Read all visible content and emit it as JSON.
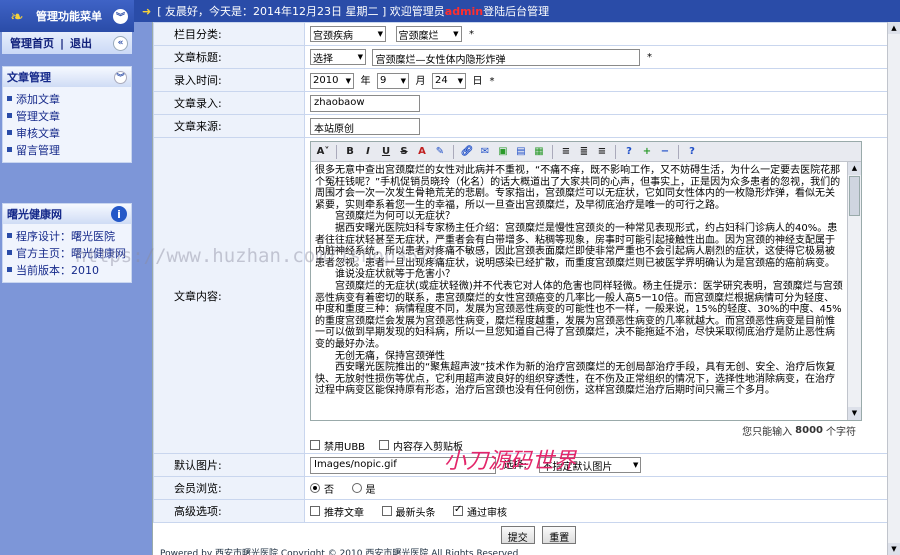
{
  "sidebar": {
    "header_title": "管理功能菜单",
    "nav_home": "管理首页",
    "nav_sep": "|",
    "nav_logout": "退出",
    "article_box": {
      "title": "文章管理",
      "items": [
        "添加文章",
        "管理文章",
        "审核文章",
        "留言管理"
      ]
    },
    "info_box": {
      "title": "曙光健康网",
      "items": [
        "程序设计：曙光医院",
        "官方主页：曙光健康网",
        "当前版本：2010"
      ]
    }
  },
  "topbar": {
    "text_before": "[ 友晨好，今天是：2014年12月23日 星期二 ] 欢迎管理员",
    "admin_name": "admin",
    "text_after": "登陆后台管理"
  },
  "form": {
    "category_label": "栏目分类:",
    "category_value": "宫颈疾病",
    "subcategory_value": "宫颈糜烂",
    "title_label": "文章标题:",
    "title_select": "选择",
    "title_value": "宫颈糜烂—女性体内隐形炸弹",
    "date_label": "录入时间:",
    "year_value": "2010",
    "year_unit": "年",
    "month_value": "9",
    "month_unit": "月",
    "day_value": "24",
    "day_unit": "日",
    "author_label": "文章录入:",
    "author_value": "zhaobaow",
    "source_label": "文章来源:",
    "source_value": "本站原创",
    "content_label": "文章内容:",
    "content_paragraphs": [
      "很多无意中查出宫颈糜烂的女性对此病并不重视，“不痛不痒，既不影响工作，又不妨碍生活，为什么一定要去医院花那个冤枉钱呢？”手机促销员晓玲（化名）的话大概道出了大家共同的心声，但事实上，正是因为众多患者的忽视，我们的周围才会一次一次发生骨艳荒芜的悲剧。专家指出，宫颈糜烂可以无症状，它如同女性体内的一枚隐形炸弹，看似无关紧要，实则牵系着您一生的幸福，所以一旦查出宫颈糜烂，及早彻底治疗是唯一的可行之路。",
      "　　宫颈糜烂为何可以无症状？",
      "　　据西安曙光医院妇科专家杨主任介绍：宫颈糜烂是慢性宫颈炎的一种常见表现形式，约占妇科门诊病人的40%。患者往往症状轻甚至无症状，严重者会有白带增多、粘稠等现象，房事时可能引起接触性出血。因为宫颈的神经支配属于内脏神经系统，所以患者对疼痛不敏感，因此宫颈表面糜烂即使非常严重也不会引起病人剧烈的症状，这使得它极易被患者忽视。患者一旦出现疼痛症状，说明感染已经扩散，而重度宫颈糜烂则已被医学界明确认为是宫颈癌的癌前病变。",
      "　　谁说没症状就等于危害小？",
      "　　宫颈糜烂的无症状(或症状轻微)并不代表它对人体的危害也同样轻微。杨主任提示：医学研究表明，宫颈糜烂与宫颈恶性病变有着密切的联系，患宫颈糜烂的女性宫颈癌变的几率比一般人高5一10倍。而宫颈糜烂根据病情可分为轻度、中度和重度三种：病情程度不同，发展为宫颈恶性病变的可能性也不一样，一般来说，15%的轻度、30%的中度、45%的重度宫颈糜烂会发展为宫颈恶性病变，糜烂程度越重，发展为宫颈恶性病变的几率就越大。而宫颈恶性病变是目前惟一可以做到早期发现的妇科病，所以一旦您知道自己得了宫颈糜烂，决不能拖延不治，尽快采取彻底治疗是防止恶性病变的最好办法。",
      "　　无创无痛，保持宫颈弹性",
      "　　西安曙光医院推出的“聚焦超声波”技术作为新的治疗宫颈糜烂的无创局部治疗手段，具有无创、安全、治疗后恢复快、无放射性损伤等优点，它利用超声波良好的组织穿透性，在不伤及正常组织的情况下，选择性地消除病变，在治疗过程中病变区能保持原有形态，治疗后宫颈也没有任何创伤，这样宫颈糜烂治疗后期时间只需三个多月。"
    ],
    "char_count_before": "您只能输入",
    "char_count_value": "8000",
    "char_count_after": "个字符",
    "opt_ubb": "禁用UBB",
    "opt_clipboard": "内容存入剪贴板",
    "image_label": "默认图片:",
    "image_value": "Images/nopic.gif",
    "image_select_label": "选择:",
    "image_select_value": "不指定默认图片",
    "member_label": "会员浏览:",
    "member_no": "否",
    "member_yes": "是",
    "advanced_label": "高级选项:",
    "adv_recommend": "推荐文章",
    "adv_headline": "最新头条",
    "adv_approved": "通过审核",
    "submit_label": "提交",
    "reset_label": "重置"
  },
  "watermark": "https://www.huzhan.com/1shop3572",
  "brandmark": "小刀源码世界",
  "footer": "Powered by 西安市曙光医院 Copyright © 2010 西安市曙光医院 All Rights Reserved"
}
